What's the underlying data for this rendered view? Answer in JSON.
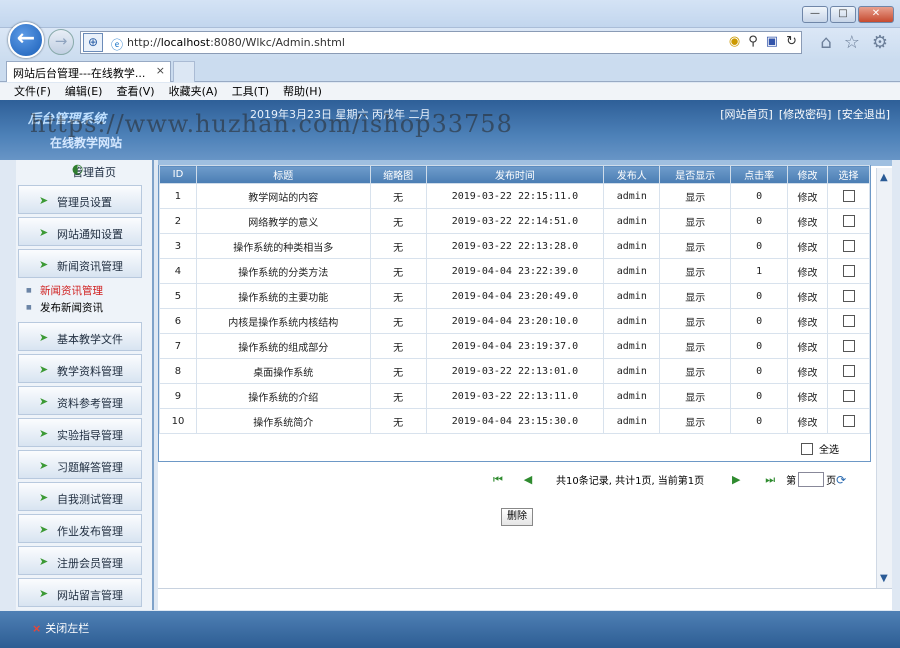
{
  "browser": {
    "window_buttons": [
      "—",
      "□",
      "✕"
    ],
    "url_prefix": "http://",
    "url_host": "localhost",
    "url_rest": ":8080/Wlkc/Admin.shtml",
    "tab_title": "网站后台管理---在线教学...",
    "tab_close": "×",
    "menu": [
      "文件(F)",
      "编辑(E)",
      "查看(V)",
      "收藏夹(A)",
      "工具(T)",
      "帮助(H)"
    ]
  },
  "header": {
    "logo": "后台管理系统",
    "site_name": "在线教学网站",
    "dateline": "2019年3月23日 星期六 丙戌年 二月",
    "links": [
      "[网站首页]",
      "[修改密码]",
      "[安全退出]"
    ],
    "watermark": "https://www.huzhan.com/ishop33758"
  },
  "sidebar": {
    "home": "管理首页",
    "items": [
      {
        "label": "管理员设置"
      },
      {
        "label": "网站通知设置"
      },
      {
        "label": "新闻资讯管理"
      },
      {
        "label": "基本教学文件"
      },
      {
        "label": "教学资料管理"
      },
      {
        "label": "资料参考管理"
      },
      {
        "label": "实验指导管理"
      },
      {
        "label": "习题解答管理"
      },
      {
        "label": "自我测试管理"
      },
      {
        "label": "作业发布管理"
      },
      {
        "label": "注册会员管理"
      },
      {
        "label": "网站留言管理"
      }
    ],
    "sublinks": [
      "新闻资讯管理",
      "发布新闻资讯"
    ]
  },
  "table": {
    "headers": [
      "ID",
      "标题",
      "缩略图",
      "发布时间",
      "发布人",
      "是否显示",
      "点击率",
      "修改",
      "选择"
    ],
    "rows": [
      {
        "id": "1",
        "title": "教学网站的内容",
        "thumb": "无",
        "time": "2019-03-22 22:15:11.0",
        "author": "admin",
        "show": "显示",
        "hits": "0",
        "edit": "修改"
      },
      {
        "id": "2",
        "title": "网络教学的意义",
        "thumb": "无",
        "time": "2019-03-22 22:14:51.0",
        "author": "admin",
        "show": "显示",
        "hits": "0",
        "edit": "修改"
      },
      {
        "id": "3",
        "title": "操作系统的种类相当多",
        "thumb": "无",
        "time": "2019-03-22 22:13:28.0",
        "author": "admin",
        "show": "显示",
        "hits": "0",
        "edit": "修改"
      },
      {
        "id": "4",
        "title": "操作系统的分类方法",
        "thumb": "无",
        "time": "2019-04-04 23:22:39.0",
        "author": "admin",
        "show": "显示",
        "hits": "1",
        "edit": "修改"
      },
      {
        "id": "5",
        "title": "操作系统的主要功能",
        "thumb": "无",
        "time": "2019-04-04 23:20:49.0",
        "author": "admin",
        "show": "显示",
        "hits": "0",
        "edit": "修改"
      },
      {
        "id": "6",
        "title": "内核是操作系统内核结构",
        "thumb": "无",
        "time": "2019-04-04 23:20:10.0",
        "author": "admin",
        "show": "显示",
        "hits": "0",
        "edit": "修改"
      },
      {
        "id": "7",
        "title": "操作系统的组成部分",
        "thumb": "无",
        "time": "2019-04-04 23:19:37.0",
        "author": "admin",
        "show": "显示",
        "hits": "0",
        "edit": "修改"
      },
      {
        "id": "8",
        "title": "桌面操作系统",
        "thumb": "无",
        "time": "2019-03-22 22:13:01.0",
        "author": "admin",
        "show": "显示",
        "hits": "0",
        "edit": "修改"
      },
      {
        "id": "9",
        "title": "操作系统的介绍",
        "thumb": "无",
        "time": "2019-03-22 22:13:11.0",
        "author": "admin",
        "show": "显示",
        "hits": "0",
        "edit": "修改"
      },
      {
        "id": "10",
        "title": "操作系统简介",
        "thumb": "无",
        "time": "2019-04-04 23:15:30.0",
        "author": "admin",
        "show": "显示",
        "hits": "0",
        "edit": "修改"
      }
    ],
    "select_all": "全选"
  },
  "pager": {
    "summary": "共10条记录, 共计1页, 当前第1页",
    "page_prefix": "第",
    "page_suffix": "页",
    "first": "⏮",
    "prev": "◀",
    "next": "▶",
    "last": "⏭"
  },
  "delete_label": "删除",
  "footer": {
    "close_sidebar": "关闭左栏"
  }
}
